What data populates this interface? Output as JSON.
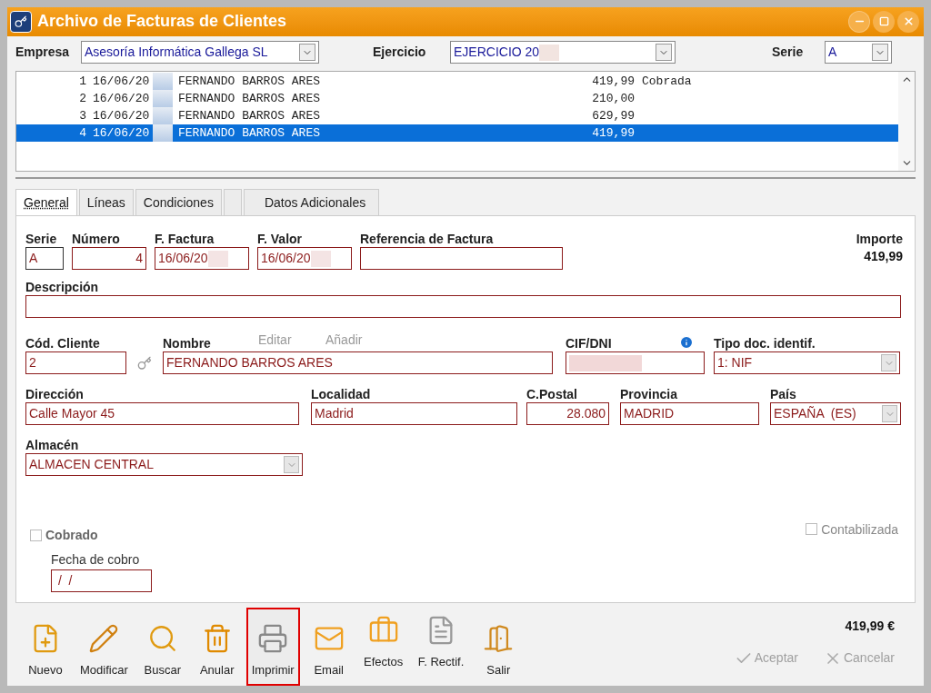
{
  "window": {
    "title": "Archivo de Facturas de Clientes"
  },
  "filters": [
    {
      "label": "Empresa",
      "value": "Asesoría Informática Gallega SL"
    },
    {
      "label": "Ejercicio",
      "value": "EJERCICIO 20"
    },
    {
      "label": "Serie",
      "value": "A"
    }
  ],
  "invoice_list": {
    "rows": [
      {
        "number": "1",
        "date": "16/06/20",
        "client": "FERNANDO BARROS ARES",
        "amount": "419,99",
        "status": "Cobrada",
        "selected": false
      },
      {
        "number": "2",
        "date": "16/06/20",
        "client": "FERNANDO BARROS ARES",
        "amount": "210,00",
        "selected": false
      },
      {
        "number": "3",
        "date": "16/06/20",
        "client": "FERNANDO BARROS ARES",
        "amount": "629,99",
        "selected": false
      },
      {
        "number": "4",
        "date": "16/06/20",
        "client": "FERNANDO BARROS ARES",
        "amount": "419,99",
        "selected": true
      }
    ]
  },
  "tabs": [
    {
      "label": "General",
      "selected": true
    },
    {
      "label": "Líneas",
      "selected": false
    },
    {
      "label": "Condiciones",
      "selected": false
    },
    {
      "label": "Datos Adicionales",
      "selected": false
    }
  ],
  "form": {
    "serie": {
      "label": "Serie",
      "value": "A"
    },
    "numero": {
      "label": "Número",
      "value": "4"
    },
    "f_factura": {
      "label": "F. Factura",
      "value": "16/06/20"
    },
    "f_valor": {
      "label": "F. Valor",
      "value": "16/06/20"
    },
    "referencia": {
      "label": "Referencia de Factura"
    },
    "importe": {
      "label": "Importe",
      "value": "419,99"
    },
    "descripcion": {
      "label": "Descripción"
    },
    "cod_cliente": {
      "label": "Cód. Cliente",
      "value": "2"
    },
    "nombre": {
      "label": "Nombre",
      "value": "FERNANDO BARROS ARES"
    },
    "links": [
      {
        "label": "Editar",
        "disabled": true
      },
      {
        "label": "Añadir",
        "disabled": true
      }
    ],
    "cif": {
      "label": "CIF/DNI"
    },
    "tipo_doc": {
      "label": "Tipo doc. identif.",
      "value": "1: NIF"
    },
    "direccion": {
      "label": "Dirección",
      "value": "Calle Mayor 45"
    },
    "localidad": {
      "label": "Localidad",
      "value": "Madrid"
    },
    "cpostal": {
      "label": "C.Postal",
      "value": "28.080"
    },
    "provincia": {
      "label": "Provincia",
      "value": "MADRID"
    },
    "pais": {
      "label": "País",
      "value": "ESPAÑA  (ES)"
    },
    "almacen": {
      "label": "Almacén",
      "value": "ALMACEN CENTRAL"
    },
    "cobrado": {
      "label": "Cobrado",
      "checked": false
    },
    "fecha_cobro": {
      "label": "Fecha de cobro",
      "value": " /  /"
    },
    "contabilizada": {
      "label": "Contabilizada",
      "checked": false
    }
  },
  "toolbar": [
    {
      "kind": "new",
      "label": "Nuevo",
      "selected": false
    },
    {
      "kind": "edit",
      "label": "Modificar",
      "selected": false
    },
    {
      "kind": "search",
      "label": "Buscar",
      "selected": false
    },
    {
      "kind": "delete",
      "label": "Anular",
      "selected": false
    },
    {
      "kind": "print",
      "label": "Imprimir",
      "selected": true
    },
    {
      "kind": "email",
      "label": "Email",
      "selected": false
    },
    {
      "kind": "effects",
      "label": "Efectos",
      "selected": false
    },
    {
      "kind": "rectify",
      "label": "F. Rectif.",
      "selected": false
    },
    {
      "kind": "exit",
      "label": "Salir",
      "selected": false
    }
  ],
  "total": "419,99 €",
  "actions": [
    {
      "kind": "accept",
      "label": "Aceptar",
      "disabled": true
    },
    {
      "kind": "cancel",
      "label": "Cancelar",
      "disabled": true
    }
  ]
}
